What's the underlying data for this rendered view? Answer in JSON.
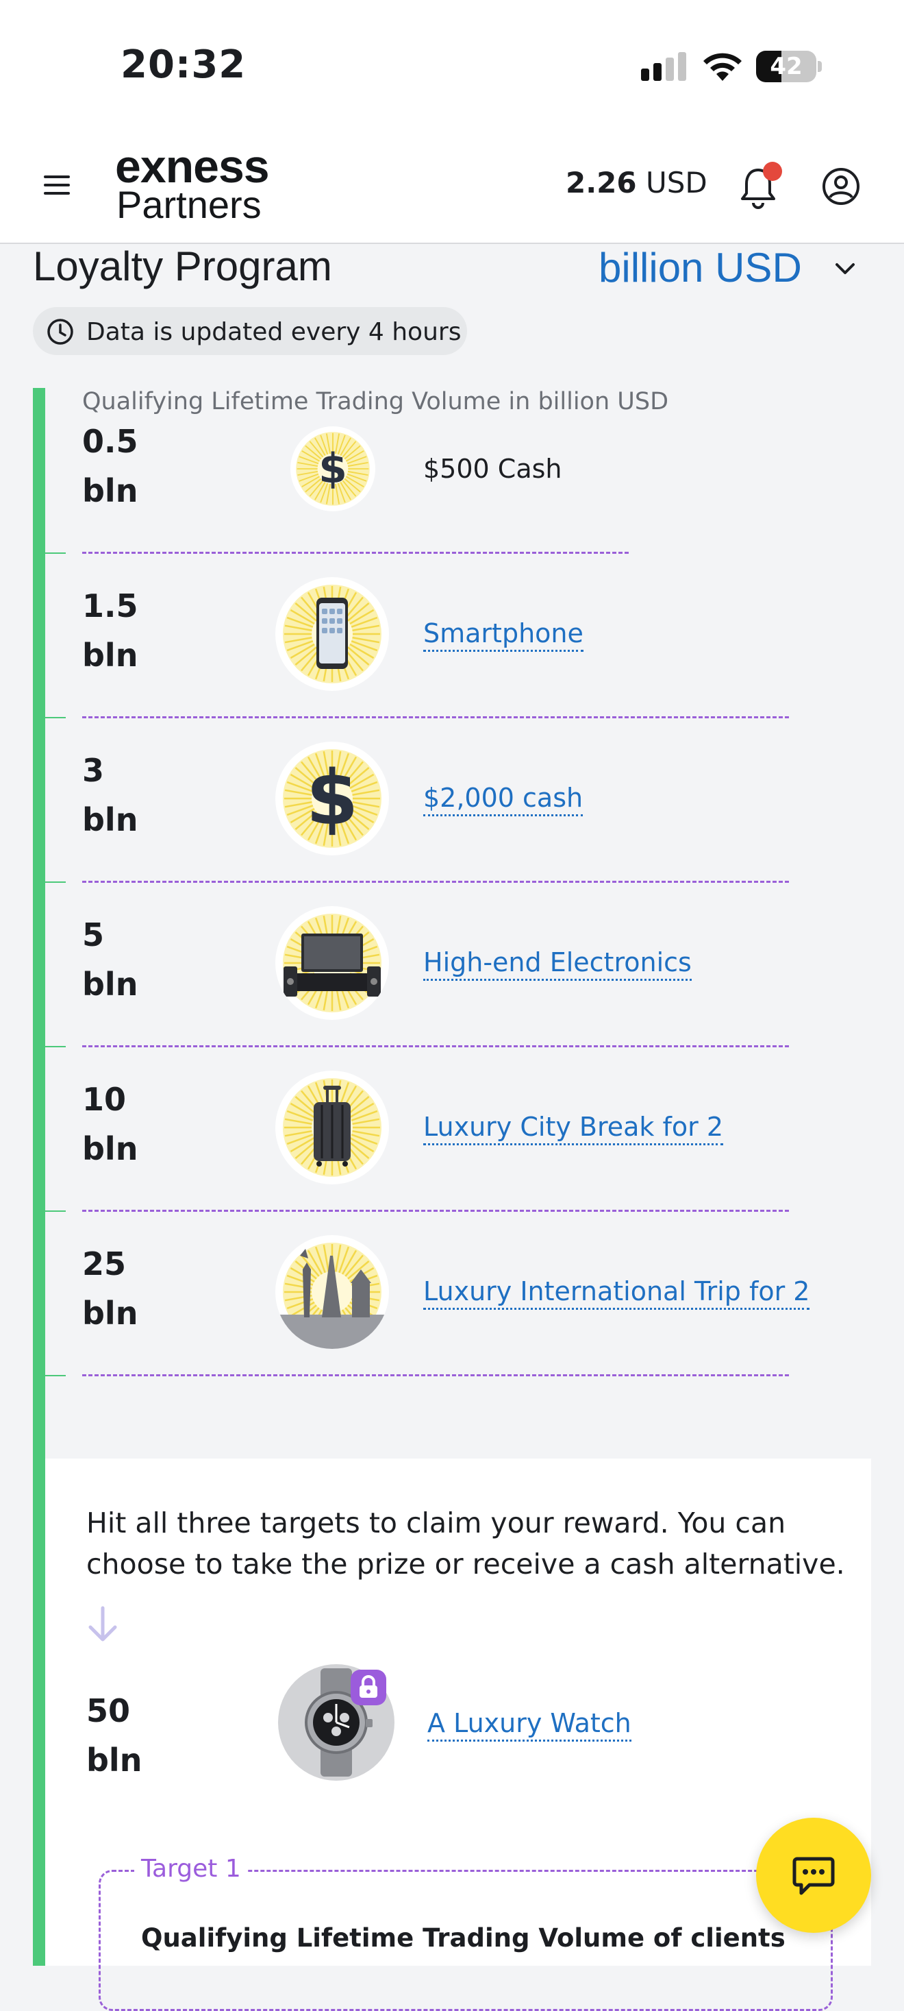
{
  "status_bar": {
    "time": "20:32",
    "battery_level": "42",
    "battery_fraction": 0.42
  },
  "header": {
    "logo_top": "exness",
    "logo_bottom": "Partners",
    "balance_amount": "2.26",
    "balance_currency": "USD",
    "has_notification": true
  },
  "page": {
    "title": "Loyalty Program",
    "unit_selector": "billion USD",
    "update_note": "Data is updated every 4 hours",
    "caption": "Qualifying Lifetime Trading Volume in billion USD"
  },
  "tiers": [
    {
      "volume": "0.5\nbln",
      "reward": "$500 Cash",
      "icon": "dollar-icon",
      "link": false
    },
    {
      "volume": "1.5\nbln",
      "reward": "Smartphone",
      "icon": "smartphone-icon",
      "link": true
    },
    {
      "volume": "3\nbln",
      "reward": "$2,000 cash",
      "icon": "dollar-icon",
      "link": true
    },
    {
      "volume": "5\nbln",
      "reward": "High-end Electronics",
      "icon": "tv-icon",
      "link": true
    },
    {
      "volume": "10\nbln",
      "reward": "Luxury City Break for 2",
      "icon": "suitcase-icon",
      "link": true
    },
    {
      "volume": "25\nbln",
      "reward": "Luxury International Trip for 2",
      "icon": "landmarks-icon",
      "link": true
    }
  ],
  "final": {
    "text": "Hit all three targets to claim your reward. You can choose to take the prize or receive a cash alternative.",
    "volume": "50\nbln",
    "reward": "A Luxury Watch",
    "icon": "watch-icon",
    "locked": true
  },
  "target": {
    "label": "Target 1",
    "title": "Qualifying Lifetime Trading Volume of clients"
  },
  "colors": {
    "accent_blue": "#1e6fc2",
    "timeline_green": "#4cc97a",
    "dash_purple": "#9a60d8",
    "chat_yellow": "#ffdd22"
  }
}
